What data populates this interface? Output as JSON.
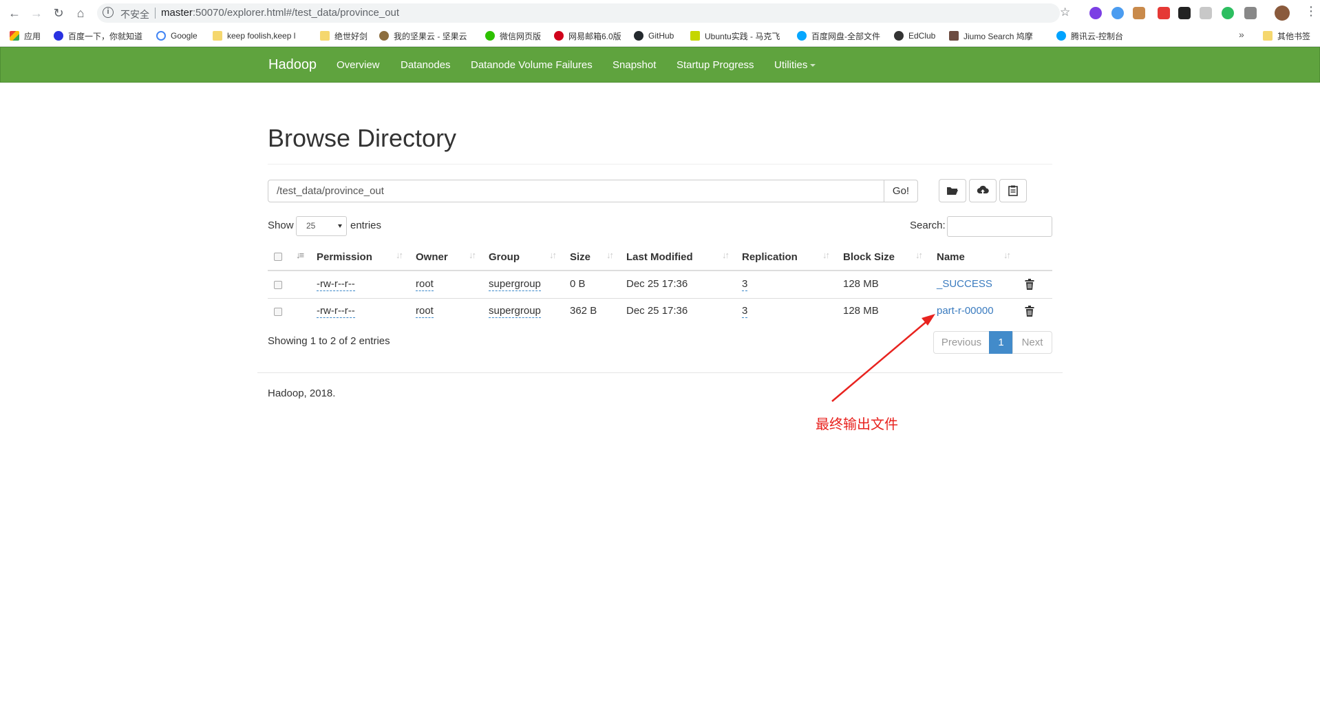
{
  "browser": {
    "insecure_label": "不安全",
    "url_host": "master",
    "url_rest": ":50070/explorer.html#/test_data/province_out",
    "bookmarks": [
      {
        "label": "应用",
        "icon": "apps-grid-icon",
        "color": "#4285f4"
      },
      {
        "label": "百度一下，你就知道",
        "icon": "baidu-paw-icon",
        "color": "#2932e1"
      },
      {
        "label": "Google",
        "icon": "google-g-icon",
        "color": "#4285f4"
      },
      {
        "label": "keep foolish,keep l",
        "icon": "folder-icon",
        "color": "#f5d76e"
      },
      {
        "label": "绝世好剑",
        "icon": "folder-icon",
        "color": "#f5d76e"
      },
      {
        "label": "我的坚果云 - 坚果云",
        "icon": "nut-icon",
        "color": "#8d6e3f"
      },
      {
        "label": "微信网页版",
        "icon": "wechat-icon",
        "color": "#2dc100"
      },
      {
        "label": "网易邮箱6.0版",
        "icon": "netease-mail-icon",
        "color": "#d0021b"
      },
      {
        "label": "GitHub",
        "icon": "github-icon",
        "color": "#24292e"
      },
      {
        "label": "Ubuntu实践 - 马克飞",
        "icon": "maxiang-icon",
        "color": "#c5d600"
      },
      {
        "label": "百度网盘-全部文件",
        "icon": "baidu-pan-icon",
        "color": "#06a7ff"
      },
      {
        "label": "EdClub",
        "icon": "edclub-icon",
        "color": "#333333"
      },
      {
        "label": "Jiumo Search 鸠摩",
        "icon": "jiumo-icon",
        "color": "#6d4c41"
      },
      {
        "label": "腾讯云-控制台",
        "icon": "tencent-cloud-icon",
        "color": "#00a3ff"
      }
    ],
    "more_chevron": "»",
    "other_bookmarks": "其他书签"
  },
  "navbar": {
    "brand": "Hadoop",
    "items": [
      "Overview",
      "Datanodes",
      "Datanode Volume Failures",
      "Snapshot",
      "Startup Progress",
      "Utilities"
    ]
  },
  "page": {
    "title": "Browse Directory",
    "path_value": "/test_data/province_out",
    "go_label": "Go!",
    "show_label": "Show",
    "page_size": "25",
    "entries_label": "entries",
    "search_label": "Search:",
    "info": "Showing 1 to 2 of 2 entries",
    "pagination": {
      "previous": "Previous",
      "current": "1",
      "next": "Next"
    },
    "footer": "Hadoop, 2018.",
    "annotation": "最终输出文件"
  },
  "table": {
    "columns": [
      "Permission",
      "Owner",
      "Group",
      "Size",
      "Last Modified",
      "Replication",
      "Block Size",
      "Name"
    ],
    "rows": [
      {
        "permission": "-rw-r--r--",
        "owner": "root",
        "group": "supergroup",
        "size": "0 B",
        "modified": "Dec 25 17:36",
        "replication": "3",
        "block_size": "128 MB",
        "name": "_SUCCESS"
      },
      {
        "permission": "-rw-r--r--",
        "owner": "root",
        "group": "supergroup",
        "size": "362 B",
        "modified": "Dec 25 17:36",
        "replication": "3",
        "block_size": "128 MB",
        "name": "part-r-00000"
      }
    ]
  },
  "colors": {
    "navbar_bg": "#5fa33e",
    "link": "#3a7bbf",
    "pagination_active": "#428bca",
    "annotation": "#e8231f"
  }
}
